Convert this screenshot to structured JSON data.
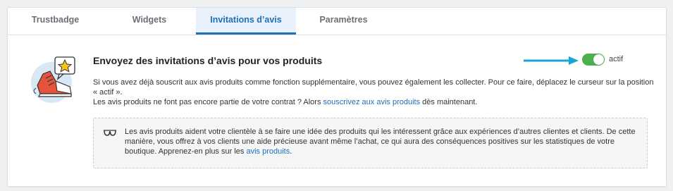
{
  "tabs": [
    {
      "label": "Trustbadge"
    },
    {
      "label": "Widgets"
    },
    {
      "label": "Invitations d’avis"
    },
    {
      "label": "Paramètres"
    }
  ],
  "active_tab": "Invitations d’avis",
  "section": {
    "title": "Envoyez des invitations d’avis pour vos produits",
    "toggle": {
      "label": "actif",
      "state": "on",
      "color": "#4caf50"
    },
    "description_line1": "Si vous avez déjà souscrit aux avis produits comme fonction supplémentaire, vous pouvez également les collecter. Pour ce faire, déplacez le curseur sur la position « actif ».",
    "description_line2_prefix": "Les avis produits ne font pas encore partie de votre contrat ?  Alors ",
    "description_line2_link": "souscrivez aux avis produits",
    "description_line2_suffix": " dès maintenant."
  },
  "info_box": {
    "icon": "glasses-icon",
    "text": "Les avis produits aident votre clientèle à se faire une idée des produits qui les intéressent grâce aux expériences d’autres clientes et clients. De cette manière, vous offrez à vos clients une aide précieuse avant même l’achat, ce qui aura des conséquences positives sur les statistiques de votre boutique. Apprenez-en plus sur les ",
    "link": "avis produits",
    "suffix": "."
  },
  "colors": {
    "accent": "#1d6fb8",
    "arrow": "#1aa3d6",
    "toggle_on": "#4caf50"
  }
}
